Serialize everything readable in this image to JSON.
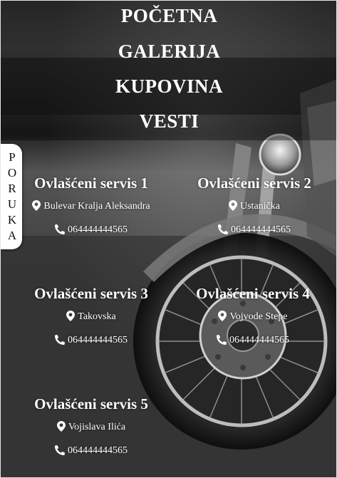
{
  "nav": {
    "items": [
      {
        "label": "POČETNA"
      },
      {
        "label": "GALERIJA"
      },
      {
        "label": "KUPOVINA"
      },
      {
        "label": "VESTI"
      }
    ]
  },
  "side_tab": {
    "letters": [
      "P",
      "O",
      "R",
      "U",
      "K",
      "A"
    ]
  },
  "services": [
    {
      "title": "Ovlašćeni servis 1",
      "address": "Bulevar Kralja Aleksandra",
      "phone": "064444444565"
    },
    {
      "title": "Ovlašćeni servis 2",
      "address": "Ustanička",
      "phone": "064444444565"
    },
    {
      "title": "Ovlašćeni servis 3",
      "address": "Takovska",
      "phone": "064444444565"
    },
    {
      "title": "Ovlašćeni servis 4",
      "address": "Vojvode Stepe",
      "phone": "064444444565"
    },
    {
      "title": "Ovlašćeni servis 5",
      "address": "Vojislava Ilića",
      "phone": "064444444565"
    }
  ],
  "icons": {
    "address": "map-marker-icon",
    "phone": "phone-icon"
  },
  "colors": {
    "text": "#ffffff",
    "tab_background": "#ffffff",
    "tab_text": "#111111"
  }
}
